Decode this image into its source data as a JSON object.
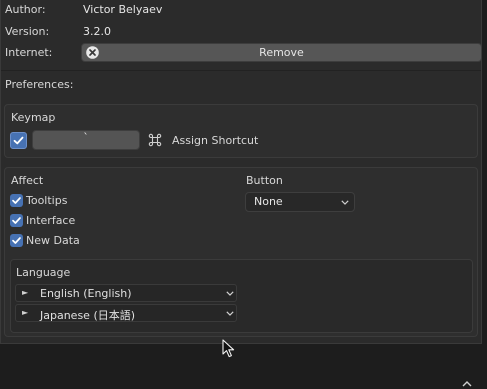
{
  "addon_info": {
    "author_label": "Author:",
    "author_value": "Victor Belyaev",
    "version_label": "Version:",
    "version_value": "3.2.0",
    "internet_label": "Internet:",
    "remove_label": "Remove"
  },
  "preferences": {
    "title": "Preferences:",
    "keymap": {
      "title": "Keymap",
      "enabled": true,
      "key_value": "`",
      "assign_label": "Assign Shortcut"
    },
    "affect": {
      "title": "Affect",
      "items": [
        {
          "label": "Tooltips",
          "checked": true
        },
        {
          "label": "Interface",
          "checked": true
        },
        {
          "label": "New Data",
          "checked": true
        }
      ]
    },
    "button": {
      "title": "Button",
      "selected": "None"
    },
    "language": {
      "title": "Language",
      "items": [
        {
          "label": "English (English)"
        },
        {
          "label": "Japanese (日本語)"
        }
      ]
    }
  },
  "colors": {
    "accent": "#4772b3",
    "panel_bg": "#2b2b2b",
    "button_bg": "#565656"
  }
}
